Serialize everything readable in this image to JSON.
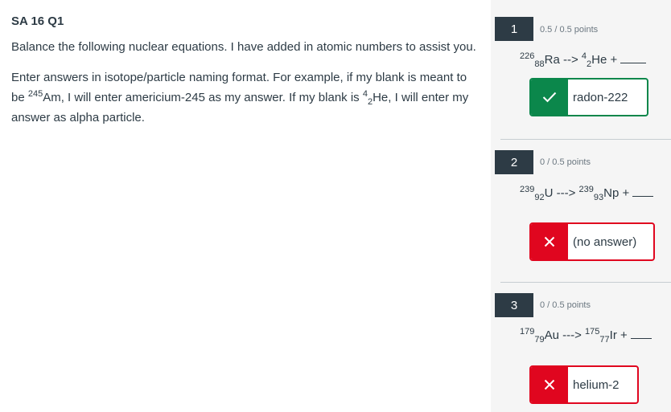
{
  "title": "SA 16 Q1",
  "instructions": {
    "line1": "Balance the following nuclear equations. I have added in atomic numbers to assist you.",
    "line2_a": "Enter answers in isotope/particle naming format. For example, if my blank is meant to be ",
    "ex1_mass": "245",
    "ex1_sym": "Am, I will enter americium-245 as my answer. If my blank is ",
    "ex2_mass": "4",
    "ex2_z": "2",
    "ex2_sym": "He, I will enter my answer as alpha particle."
  },
  "questions": [
    {
      "number": "1",
      "points": "0.5 / 0.5 points",
      "eq": {
        "a_mass": "226",
        "a_z": "88",
        "a_sym": "Ra -->",
        "b_mass": "4",
        "b_z": "2",
        "b_sym": "He +"
      },
      "answer": "radon-222",
      "status": "correct"
    },
    {
      "number": "2",
      "points": "0 / 0.5 points",
      "eq": {
        "a_mass": "239",
        "a_z": "92",
        "a_sym": "U --->",
        "b_mass": "239",
        "b_z": "93",
        "b_sym": "Np +"
      },
      "answer": "(no answer)",
      "status": "incorrect"
    },
    {
      "number": "3",
      "points": "0 / 0.5 points",
      "eq": {
        "a_mass": "179",
        "a_z": "79",
        "a_sym": "Au --->",
        "b_mass": "175",
        "b_z": "77",
        "b_sym": "Ir +"
      },
      "answer": "helium-2",
      "status": "incorrect"
    }
  ],
  "colors": {
    "correct": "#0b874b",
    "incorrect": "#e0061f",
    "badge": "#2d3b45"
  },
  "icons": {
    "correct": "check-icon",
    "incorrect": "x-icon"
  }
}
